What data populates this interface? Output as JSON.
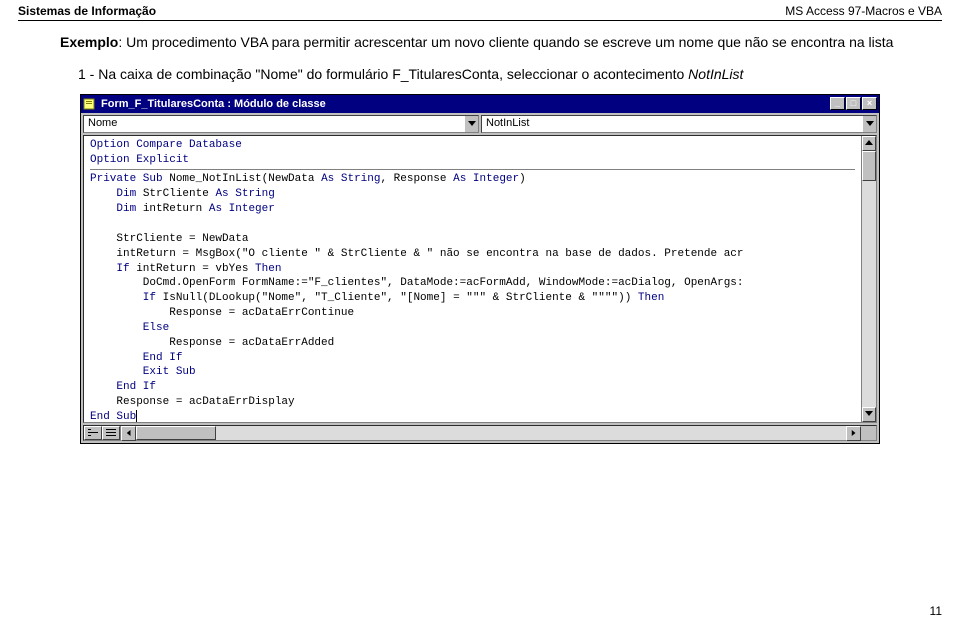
{
  "header": {
    "left": "Sistemas de Informação",
    "right": "MS Access 97-Macros e VBA"
  },
  "para1": {
    "label": "Exemplo",
    "text": ": Um procedimento VBA para permitir acrescentar um novo cliente quando se escreve um nome que não se encontra na lista"
  },
  "para2": {
    "prefix": "1 - Na caixa de combinação \"Nome\" do formulário ",
    "bold": "F_TitularesConta,",
    "mid": " seleccionar o acontecimento ",
    "italic": "NotInList"
  },
  "vba": {
    "title": "Form_F_TitularesConta : Módulo de classe",
    "left_dd": "Nome",
    "right_dd": "NotInList",
    "code": {
      "l1a": "Option Compare Database",
      "l1b": "Option Explicit",
      "l2a": "Private Sub",
      "l2b": " Nome_NotInList(NewData ",
      "l2c": "As String",
      "l2d": ", Response ",
      "l2e": "As Integer",
      "l2f": ")",
      "l3a": "    Dim",
      "l3b": " StrCliente ",
      "l3c": "As String",
      "l4a": "    Dim",
      "l4b": " intReturn ",
      "l4c": "As Integer",
      "l5": "    StrCliente = NewData",
      "l6a": "    intReturn = MsgBox(\"O cliente \" & StrCliente & \" não se encontra na base de dados. Pretende acr",
      "l7a": "    If",
      "l7b": " intReturn = vbYes ",
      "l7c": "Then",
      "l8": "        DoCmd.OpenForm FormName:=\"F_clientes\", DataMode:=acFormAdd, WindowMode:=acDialog, OpenArgs:",
      "l9a": "        If",
      "l9b": " IsNull(DLookup(\"Nome\", \"T_Cliente\", \"[Nome] = \"\"\" & StrCliente & \"\"\"\")) ",
      "l9c": "Then",
      "l10": "            Response = acDataErrContinue",
      "l11": "        Else",
      "l12": "            Response = acDataErrAdded",
      "l13": "        End If",
      "l14": "        Exit Sub",
      "l15": "    End If",
      "l16": "    Response = acDataErrDisplay",
      "l17": "End Sub"
    }
  },
  "page_number": "11"
}
